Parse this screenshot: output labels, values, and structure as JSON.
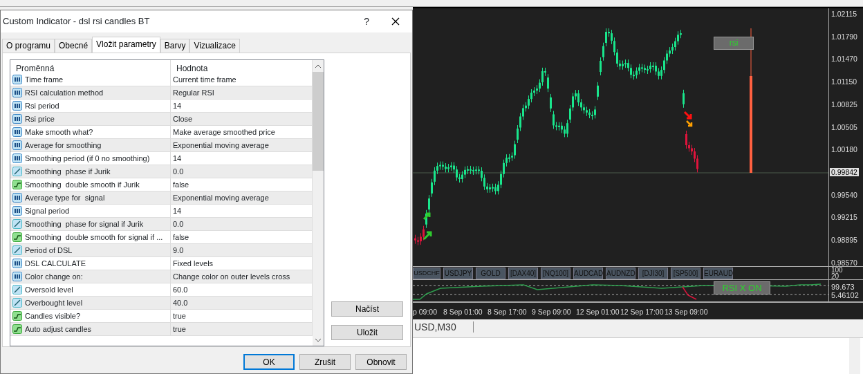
{
  "dialog": {
    "title": "Custom Indicator - dsl rsi candles BT",
    "help": "?"
  },
  "tabs": [
    {
      "label": "O programu",
      "selected": false
    },
    {
      "label": "Obecné",
      "selected": false
    },
    {
      "label": "Vložit parametry",
      "selected": true
    },
    {
      "label": "Barvy",
      "selected": false
    },
    {
      "label": "Vizualizace",
      "selected": false
    }
  ],
  "table": {
    "columns": [
      "Proměnná",
      "Hodnota"
    ],
    "rows": [
      {
        "kind": "int",
        "name": "Time frame",
        "value": "Current time frame"
      },
      {
        "kind": "int",
        "name": "RSI calculation method",
        "value": "Regular RSI"
      },
      {
        "kind": "int",
        "name": "Rsi period",
        "value": "14"
      },
      {
        "kind": "int",
        "name": "Rsi price",
        "value": "Close"
      },
      {
        "kind": "int",
        "name": "Make smooth what?",
        "value": "Make average smoothed price"
      },
      {
        "kind": "int",
        "name": "Average for smoothing",
        "value": "Exponential moving average"
      },
      {
        "kind": "int",
        "name": "Smoothing period (if 0 no smoothing)",
        "value": "14"
      },
      {
        "kind": "double",
        "name": "Smoothing  phase if Jurik",
        "value": "0.0"
      },
      {
        "kind": "bool",
        "name": "Smoothing  double smooth if Jurik",
        "value": "false"
      },
      {
        "kind": "int",
        "name": "Average type for  signal",
        "value": "Exponential moving average"
      },
      {
        "kind": "int",
        "name": "Signal period",
        "value": "14"
      },
      {
        "kind": "double",
        "name": "Smoothing  phase for signal if Jurik",
        "value": "0.0"
      },
      {
        "kind": "bool",
        "name": "Smoothing  double smooth for signal if ...",
        "value": "false"
      },
      {
        "kind": "double",
        "name": "Period of DSL",
        "value": "9.0"
      },
      {
        "kind": "int",
        "name": "DSL CALCULATE",
        "value": "Fixed levels"
      },
      {
        "kind": "int",
        "name": "Color change on:",
        "value": "Change color on outer levels cross"
      },
      {
        "kind": "double",
        "name": "Oversold level",
        "value": "60.0"
      },
      {
        "kind": "double",
        "name": "Overbought level",
        "value": "40.0"
      },
      {
        "kind": "bool",
        "name": "Candles visible?",
        "value": "true"
      },
      {
        "kind": "bool",
        "name": "Auto adjust candles",
        "value": "true"
      }
    ]
  },
  "side_buttons": [
    "Načíst",
    "Uložit"
  ],
  "buttons": [
    {
      "label": "OK",
      "default": true
    },
    {
      "label": "Zrušit",
      "default": false
    },
    {
      "label": "Obnovit",
      "default": false
    }
  ],
  "chart": {
    "price_labels": [
      {
        "text": "1.02115",
        "highlighted": false
      },
      {
        "text": "1.01790",
        "highlighted": false
      },
      {
        "text": "1.01470",
        "highlighted": false
      },
      {
        "text": "1.01150",
        "highlighted": false
      },
      {
        "text": "1.00825",
        "highlighted": false
      },
      {
        "text": "1.00505",
        "highlighted": false
      },
      {
        "text": "1.00180",
        "highlighted": false
      },
      {
        "text": "0.99842",
        "highlighted": true
      },
      {
        "text": "0.99540",
        "highlighted": false
      },
      {
        "text": "0.99215",
        "highlighted": false
      },
      {
        "text": "0.98895",
        "highlighted": false
      },
      {
        "text": "0.98570",
        "highlighted": false
      }
    ],
    "label": "rsi",
    "symbols": [
      "USDCHF",
      "USDJPY",
      "GOLD",
      "[DAX40]",
      "[NQ100]",
      "AUDCAD",
      "AUDNZD",
      "[DJI30]",
      "[SP500]",
      "EURAUD"
    ],
    "symbol_pane_labels": [
      "100",
      "20"
    ],
    "indicator_labels": [
      "99.673",
      "5.46102"
    ],
    "indicator_button": "RSI X ON",
    "time_labels": [
      "p 09:00",
      "8 Sep 01:00",
      "8 Sep 17:00",
      "9 Sep 09:00",
      "12 Sep 01:00",
      "12 Sep 17:00",
      "13 Sep 09:00"
    ]
  },
  "chart_tab": "USD,M30"
}
